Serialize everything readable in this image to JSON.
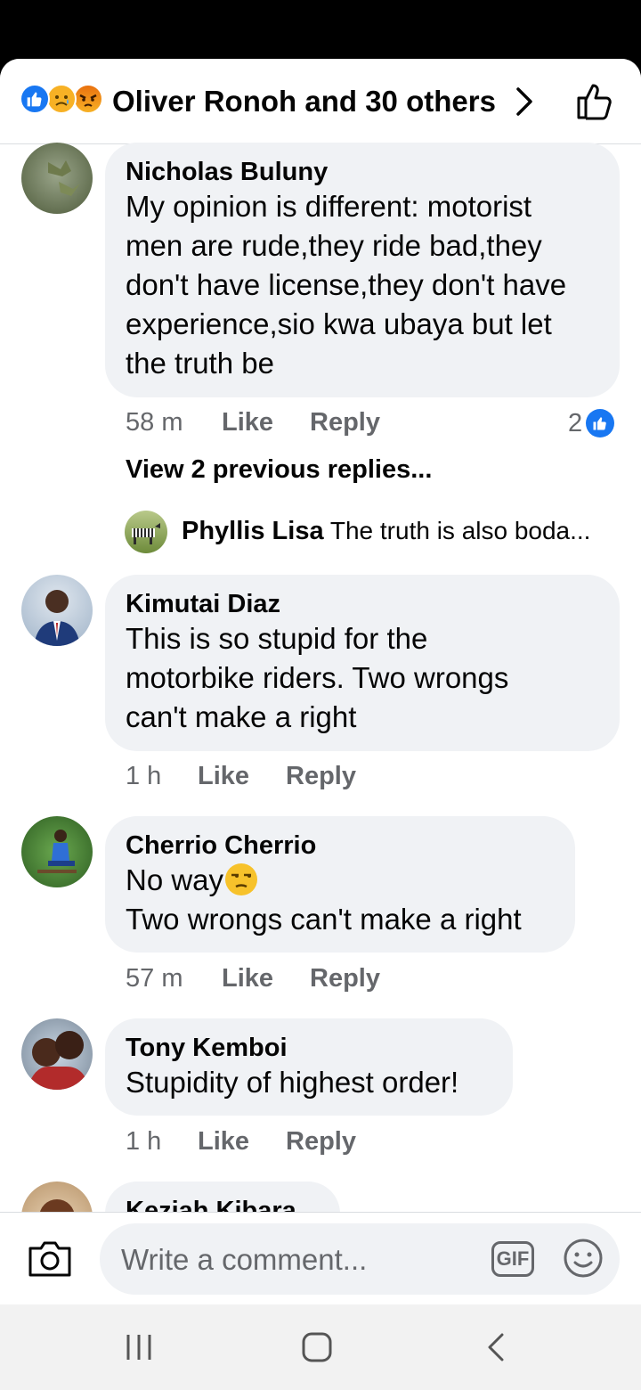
{
  "header": {
    "reactions": [
      "like-icon",
      "sad-icon",
      "angry-icon"
    ],
    "title": "Oliver Ronoh and 30 others"
  },
  "comments": [
    {
      "author": "Nicholas Buluny",
      "lines": [
        "My opinion is different: motorist",
        "men are rude,they ride bad,they",
        "don't have license,they don't have",
        "experience,sio kwa ubaya but let",
        "the truth be"
      ],
      "time": "58 m",
      "like_label": "Like",
      "reply_label": "Reply",
      "reaction_count": "2",
      "view_previous": "View 2 previous replies...",
      "latest_reply": {
        "author": "Phyllis Lisa",
        "text": "The truth is also boda..."
      }
    },
    {
      "author": "Kimutai Diaz",
      "lines": [
        "This is so stupid for the",
        "motorbike riders. Two wrongs",
        "can't make a right"
      ],
      "time": "1 h",
      "like_label": "Like",
      "reply_label": "Reply"
    },
    {
      "author": "Cherrio Cherrio",
      "lines": [
        "No way",
        "Two wrongs can't make a right"
      ],
      "emoji": "unamused-face-emoji",
      "time": "57 m",
      "like_label": "Like",
      "reply_label": "Reply"
    },
    {
      "author": "Tony Kemboi",
      "lines": [
        "Stupidity of highest order!"
      ],
      "time": "1 h",
      "like_label": "Like",
      "reply_label": "Reply"
    },
    {
      "author": "Keziah Kibara"
    }
  ],
  "composer": {
    "placeholder": "Write a comment...",
    "gif_label": "GIF"
  },
  "colors": {
    "accent": "#1877f2",
    "bubble": "#f0f2f5",
    "meta": "#65676b"
  }
}
